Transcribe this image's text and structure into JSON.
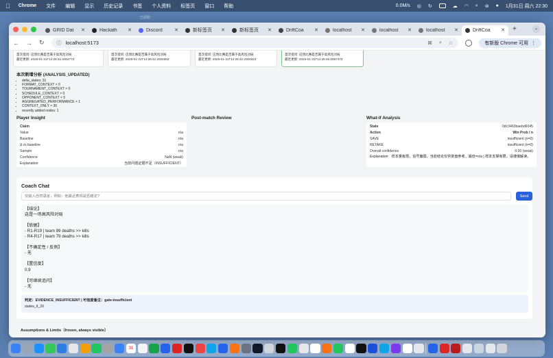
{
  "menubar": {
    "app": "Chrome",
    "items": [
      "文件",
      "编辑",
      "显示",
      "历史记录",
      "书签",
      "个人资料",
      "标签页",
      "窗口",
      "帮助"
    ],
    "net_speed": "0.0M/s",
    "datetime": "1月31日 周六 22:30"
  },
  "desktop": {
    "ghost_text": "已获取"
  },
  "tabs": [
    {
      "title": "GRID Dat",
      "icon": "grid-icon",
      "active": false
    },
    {
      "title": "Hackath",
      "icon": "hackathon-icon",
      "active": false
    },
    {
      "title": "Discord",
      "icon": "discord-icon",
      "active": false
    },
    {
      "title": "新标签页",
      "icon": "github-icon",
      "active": false
    },
    {
      "title": "新标签页",
      "icon": "github-icon",
      "active": false
    },
    {
      "title": "DriftCoa",
      "icon": "driftcoach-icon",
      "active": false
    },
    {
      "title": "localhost",
      "icon": "globe-icon",
      "active": false
    },
    {
      "title": "localhost",
      "icon": "globe-icon",
      "active": false
    },
    {
      "title": "localhost",
      "icon": "globe-icon",
      "active": false
    },
    {
      "title": "DriftCoa",
      "icon": "github-icon",
      "active": true
    }
  ],
  "address": {
    "url": "localhost:5173",
    "update_label": "有新版 Chrome 可用"
  },
  "history_cards": [
    {
      "question": "首次提问: 这场比赛是否属于高风险对局",
      "updated": "最近更新: 2026-01-31T14:28:42.200477Z",
      "highlight": false
    },
    {
      "question": "首次提问: 这场比赛是否属于高风险对局",
      "updated": "最近更新: 2026-01-31T14:28:42.200480Z",
      "highlight": false
    },
    {
      "question": "首次提问: 这场比赛是否属于高风险对局",
      "updated": "最近更新: 2026-01-31T14:28:42.200482Z",
      "highlight": false
    },
    {
      "question": "首次提问: 这场比赛是否属于高风险对局",
      "updated": "最近更新: 2026-01-31T14:28:46.806747Z",
      "highlight": true
    }
  ],
  "analysis": {
    "title": "本次新增分析 (ANALYSIS_UPDATED)",
    "items": [
      "delta_states: 31",
      "FORMAT_CONTEXT × 0",
      "TOURNAMENT_CONTEXT × 0",
      "SCHEDULE_CONTEXT × 0",
      "OPPONENT_CONTEXT × 0",
      "AGGREGATED_PERFORMANCE × 1",
      "CONTEXT_ONLY × 30",
      "recently added nodes: 1"
    ]
  },
  "player_insight": {
    "title": "Player Insight",
    "rows": [
      {
        "k": "Claim",
        "v": "",
        "bold": true
      },
      {
        "k": "Value",
        "v": "n/a"
      },
      {
        "k": "Baseline",
        "v": "n/a"
      },
      {
        "k": "Δ vs baseline",
        "v": "n/a"
      },
      {
        "k": "Sample",
        "v": "n/a"
      },
      {
        "k": "Confidence",
        "v": "NaN (weak)"
      },
      {
        "k": "Explanation",
        "v": "当前问题证据不足（INSUFFICIENT）"
      }
    ]
  },
  "post_match": {
    "title": "Post-match Review"
  },
  "whatif": {
    "title": "What-if Analysis",
    "rows": [
      {
        "k": "State",
        "v": "0dc3463baebd6045",
        "bold": true
      },
      {
        "k": "Action",
        "v": "Win Prob / n",
        "bold": true
      },
      {
        "k": "SAVE",
        "v": "insufficient (n=0)"
      },
      {
        "k": "RETAKE",
        "v": "insufficient (n=0)"
      },
      {
        "k": "Overall confidence",
        "v": "0.00 (weak)"
      }
    ],
    "explanation_label": "Explanation",
    "explanation": "样本量有限。信号偏弱，当前结论仅供复盘参考。最佳=n/a | 样本支撑有限，请谨慎解读。"
  },
  "coach_chat": {
    "title": "Coach Chat",
    "placeholder": "仅输入自然语言，例如：他最近表现是否稳定?",
    "send_label": "Send",
    "answer": {
      "conclusion_h": "【结论】",
      "conclusion": "这是一场高风险对局",
      "basis_h": "【依据】",
      "basis_1": "- R1-R19 | team 99 deaths >> kills",
      "basis_2": "- R4-R17 | team 79 deaths >> kills",
      "uncertain_h": "【不确定性 / 反例】",
      "uncertain": "- 无",
      "confidence_h": "【置信度】",
      "confidence": "0.9",
      "followup_h": "【可继续追问】",
      "followup": "- 无"
    },
    "verdict": "判定：EVIDENCE_INSUFFICIENT | 可信度备注：gate-insufficient",
    "states": "states_lt_20"
  },
  "assumptions_title": "Assumptions & Limits（frozen, always visible）"
}
